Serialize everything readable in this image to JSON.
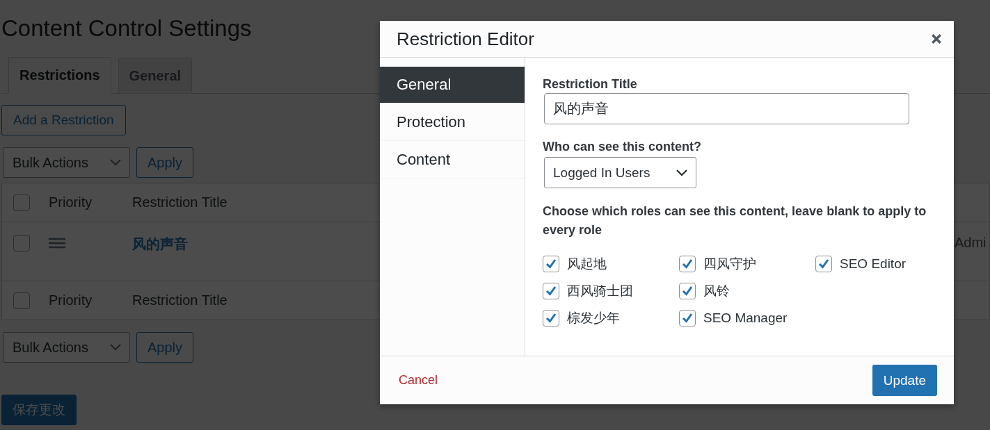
{
  "page": {
    "title": "Content Control Settings",
    "tabs": [
      {
        "label": "Restrictions",
        "selected": true
      },
      {
        "label": "General",
        "selected": false
      }
    ],
    "add_button": "Add a Restriction",
    "bulk_top": {
      "value": "Bulk Actions",
      "apply": "Apply"
    },
    "table": {
      "header": {
        "checked": false,
        "columns": [
          "Priority",
          "Restriction Title"
        ]
      },
      "rows": [
        {
          "checked": false,
          "title": "风的声音",
          "column_4": "Admi"
        }
      ],
      "footer": {
        "checked": false,
        "columns": [
          "Priority",
          "Restriction Title"
        ]
      }
    },
    "bulk_bottom": {
      "value": "Bulk Actions",
      "apply": "Apply"
    },
    "save_button": "保存更改"
  },
  "modal": {
    "title": "Restriction Editor",
    "nav": [
      {
        "label": "General",
        "selected": true
      },
      {
        "label": "Protection",
        "selected": false
      },
      {
        "label": "Content",
        "selected": false
      }
    ],
    "title_field": {
      "label": "Restriction Title",
      "value": "风的声音"
    },
    "who_field": {
      "label": "Who can see this content?",
      "value": "Logged In Users"
    },
    "roles_label": "Choose which roles can see this content, leave blank to apply to every role",
    "roles": [
      {
        "label": "风起地",
        "checked": true
      },
      {
        "label": "四风守护",
        "checked": true
      },
      {
        "label": "SEO Editor",
        "checked": true
      },
      {
        "label": "西风骑士团",
        "checked": true
      },
      {
        "label": "风铃",
        "checked": true
      },
      {
        "label": "棕发少年",
        "checked": true
      },
      {
        "label": "SEO Manager",
        "checked": true
      }
    ],
    "cancel": "Cancel",
    "update": "Update"
  }
}
